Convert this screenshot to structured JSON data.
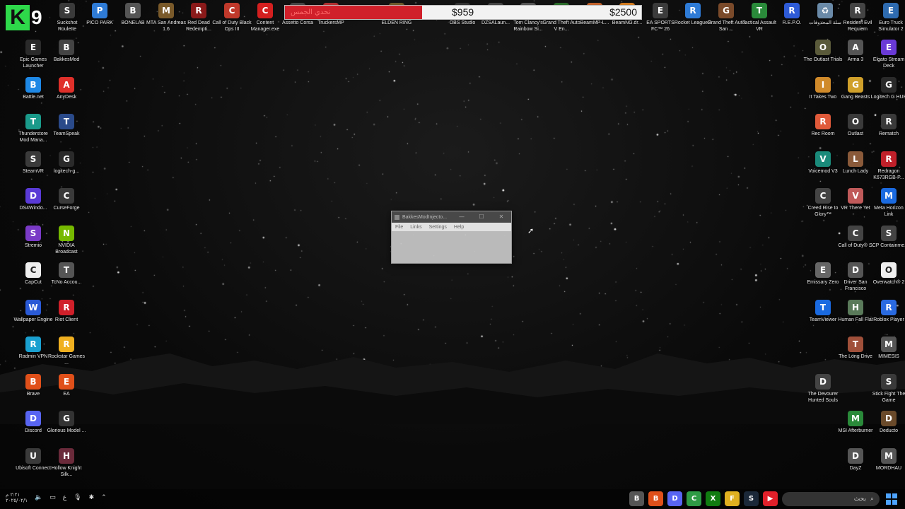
{
  "overlay": {
    "badge_k": "K",
    "badge_n": "9"
  },
  "goal": {
    "current": "$959",
    "target": "$2500",
    "progress": 0.384,
    "red_label": "تحدي الجمس"
  },
  "top_icons": [
    {
      "label": "Suckshot Roulette",
      "color": "#3a3a3a",
      "g": "S"
    },
    {
      "label": "PICO PARK",
      "color": "#2e7bd6",
      "g": "P"
    },
    {
      "label": "BONELAB",
      "color": "#555555",
      "g": "B"
    },
    {
      "label": "MTA San Andreas 1.6",
      "color": "#7a5a2a",
      "g": "M"
    },
    {
      "label": "Red Dead Redempti...",
      "color": "#8a1a1a",
      "g": "R"
    },
    {
      "label": "Call of Duty Black Ops III",
      "color": "#c0392b",
      "g": "C"
    },
    {
      "label": "Content Manager.exe",
      "color": "#d41f1f",
      "g": "C"
    },
    {
      "label": "Assetto Corsa",
      "color": "#444444",
      "g": "A"
    },
    {
      "label": "TruckersMP",
      "color": "#b03030",
      "g": "T"
    },
    {
      "label": "ELDEN RING",
      "color": "#6b5a2a",
      "g": "E"
    },
    {
      "label": "OBS Studio",
      "color": "#333333",
      "g": "O"
    },
    {
      "label": "DZSALaun...",
      "color": "#444444",
      "g": "D"
    },
    {
      "label": "Tom Clancy's Rainbow Si...",
      "color": "#555555",
      "g": "T"
    },
    {
      "label": "Grand Theft Auto V En...",
      "color": "#2a6b2a",
      "g": "G"
    },
    {
      "label": "BeamMP-L...",
      "color": "#c0612b",
      "g": "B"
    },
    {
      "label": "BeamNG.dr...",
      "color": "#d07a20",
      "g": "B"
    },
    {
      "label": "EA SPORTS FC™ 26",
      "color": "#3b3b3b",
      "g": "E"
    },
    {
      "label": "Rocket League®",
      "color": "#2e7bd6",
      "g": "R"
    },
    {
      "label": "Grand Theft Auto San ...",
      "color": "#7a4a2a",
      "g": "G"
    },
    {
      "label": "Tactical Assault VR",
      "color": "#2a8a3a",
      "g": "T"
    },
    {
      "label": "R.E.P.O.",
      "color": "#2e5bd6",
      "g": "R"
    },
    {
      "label": "سلة المحذوفات",
      "color": "#6a8aa8",
      "g": "♻"
    },
    {
      "label": "Resident Evil Requiem",
      "color": "#444444",
      "g": "R"
    },
    {
      "label": "Euro Truck Simulator 2",
      "color": "#2e6bb0",
      "g": "E"
    }
  ],
  "left_col1": [
    {
      "label": "Epic Games Launcher",
      "color": "#2a2a2a",
      "g": "E"
    },
    {
      "label": "Battle.net",
      "color": "#1e88e5",
      "g": "B"
    },
    {
      "label": "Thunderstore Mod Mana...",
      "color": "#1a9a8a",
      "g": "T"
    },
    {
      "label": "SteamVR",
      "color": "#3a3a3a",
      "g": "S"
    },
    {
      "label": "DS4Windo...",
      "color": "#5a3ad6",
      "g": "D"
    },
    {
      "label": "Stremio",
      "color": "#7a3ac6",
      "g": "S"
    },
    {
      "label": "CapCut",
      "color": "#eeeeee",
      "g": "C"
    },
    {
      "label": "Wallpaper Engine",
      "color": "#2a5ad6",
      "g": "W"
    },
    {
      "label": "Radmin VPN",
      "color": "#1aa0d0",
      "g": "R"
    },
    {
      "label": "Brave",
      "color": "#e0501a",
      "g": "B"
    },
    {
      "label": "Discord",
      "color": "#5865f2",
      "g": "D"
    },
    {
      "label": "Ubisoft Connect",
      "color": "#3a3a3a",
      "g": "U"
    }
  ],
  "left_col2": [
    {
      "label": "BakkesMod",
      "color": "#444444",
      "g": "B"
    },
    {
      "label": "AnyDesk",
      "color": "#e0302a",
      "g": "A"
    },
    {
      "label": "TeamSpeak",
      "color": "#2a4a8a",
      "g": "T"
    },
    {
      "label": "logitech-g...",
      "color": "#2a2a2a",
      "g": "G"
    },
    {
      "label": "CurseForge",
      "color": "#3a3a3a",
      "g": "C"
    },
    {
      "label": "NVIDIA Broadcast",
      "color": "#76b900",
      "g": "N"
    },
    {
      "label": "TcNo Accou...",
      "color": "#555555",
      "g": "T"
    },
    {
      "label": "Riot Client",
      "color": "#d0202a",
      "g": "R"
    },
    {
      "label": "Rockstar Games ...",
      "color": "#f0b020",
      "g": "R"
    },
    {
      "label": "EA",
      "color": "#e0501a",
      "g": "E"
    },
    {
      "label": "Glorious Model ...",
      "color": "#333333",
      "g": "G"
    },
    {
      "label": "Hollow Knight Silk...",
      "color": "#6a2a3a",
      "g": "H"
    }
  ],
  "right_col1": [
    {
      "label": "The Outlast Trials",
      "color": "#5a5a3a",
      "g": "O"
    },
    {
      "label": "It Takes Two",
      "color": "#d08a2a",
      "g": "I"
    },
    {
      "label": "Rec Room",
      "color": "#e05a3a",
      "g": "R"
    },
    {
      "label": "Voicemod V3",
      "color": "#1a8a7a",
      "g": "V"
    },
    {
      "label": "Creed Rise to Glory™",
      "color": "#444444",
      "g": "C"
    },
    {
      "label": "",
      "color": "#000000",
      "g": ""
    },
    {
      "label": "Emissary Zero",
      "color": "#666666",
      "g": "E"
    },
    {
      "label": "TeamViewer",
      "color": "#1a6ae0",
      "g": "T"
    },
    {
      "label": "",
      "color": "#000000",
      "g": ""
    },
    {
      "label": "The Devourer Hunted Souls",
      "color": "#444444",
      "g": "D"
    }
  ],
  "right_col2": [
    {
      "label": "Arma 3",
      "color": "#555555",
      "g": "A"
    },
    {
      "label": "Gang Beasts",
      "color": "#d0a02a",
      "g": "G"
    },
    {
      "label": "Outlast",
      "color": "#3a3a3a",
      "g": "O"
    },
    {
      "label": "Lunch Lady",
      "color": "#8a5a3a",
      "g": "L"
    },
    {
      "label": "VR There Yet",
      "color": "#c05a5a",
      "g": "V"
    },
    {
      "label": "Call of Duty® ...",
      "color": "#444444",
      "g": "C"
    },
    {
      "label": "Driver San Francisco",
      "color": "#555555",
      "g": "D"
    },
    {
      "label": "Human Fall Flat",
      "color": "#5a7a5a",
      "g": "H"
    },
    {
      "label": "The Long Drive",
      "color": "#a0503a",
      "g": "T"
    },
    {
      "label": "",
      "color": "#000000",
      "g": ""
    },
    {
      "label": "MSI Afterburner",
      "color": "#2a8a3a",
      "g": "M"
    },
    {
      "label": "DayZ",
      "color": "#555555",
      "g": "D"
    }
  ],
  "right_col3": [
    {
      "label": "Elgato Stream Deck",
      "color": "#6a3ad6",
      "g": "E"
    },
    {
      "label": "Logitech G HUB",
      "color": "#2a2a2a",
      "g": "G"
    },
    {
      "label": "Rematch",
      "color": "#3a3a3a",
      "g": "R"
    },
    {
      "label": "Redragon K673RGB-P...",
      "color": "#c0202a",
      "g": "R"
    },
    {
      "label": "Meta Horizon Link",
      "color": "#1a6ae0",
      "g": "M"
    },
    {
      "label": "SCP Containme...",
      "color": "#444444",
      "g": "S"
    },
    {
      "label": "Overwatch® 2",
      "color": "#eeeeee",
      "g": "O"
    },
    {
      "label": "Roblox Player",
      "color": "#2a6ae0",
      "g": "R"
    },
    {
      "label": "MIMESIS",
      "color": "#555555",
      "g": "M"
    },
    {
      "label": "Stick Fight The Game",
      "color": "#3a3a3a",
      "g": "S"
    },
    {
      "label": "Deducto",
      "color": "#6a4a2a",
      "g": "D"
    },
    {
      "label": "MORDHAU",
      "color": "#555555",
      "g": "M"
    }
  ],
  "window": {
    "title": "BakkesModInjecto...",
    "menu": [
      "File",
      "Links",
      "Settings",
      "Help"
    ],
    "min": "—",
    "max": "☐",
    "close": "✕"
  },
  "taskbar": {
    "clock_time": "٢:٢١ م",
    "clock_date": "٢٠٢٥/٠٢/١",
    "lang": "ع",
    "search_placeholder": "بحث",
    "apps": [
      {
        "name": "bakkesmod-icon",
        "color": "#555555",
        "g": "B"
      },
      {
        "name": "brave-icon",
        "color": "#e0501a",
        "g": "B"
      },
      {
        "name": "discord-icon",
        "color": "#5865f2",
        "g": "D"
      },
      {
        "name": "chrome-icon",
        "color": "#2e9b45",
        "g": "C"
      },
      {
        "name": "xbox-icon",
        "color": "#107c10",
        "g": "X"
      },
      {
        "name": "explorer-icon",
        "color": "#e0b020",
        "g": "F"
      },
      {
        "name": "steam-icon",
        "color": "#1b2838",
        "g": "S"
      },
      {
        "name": "youtube-icon",
        "color": "#e0202a",
        "g": "▶"
      }
    ]
  }
}
